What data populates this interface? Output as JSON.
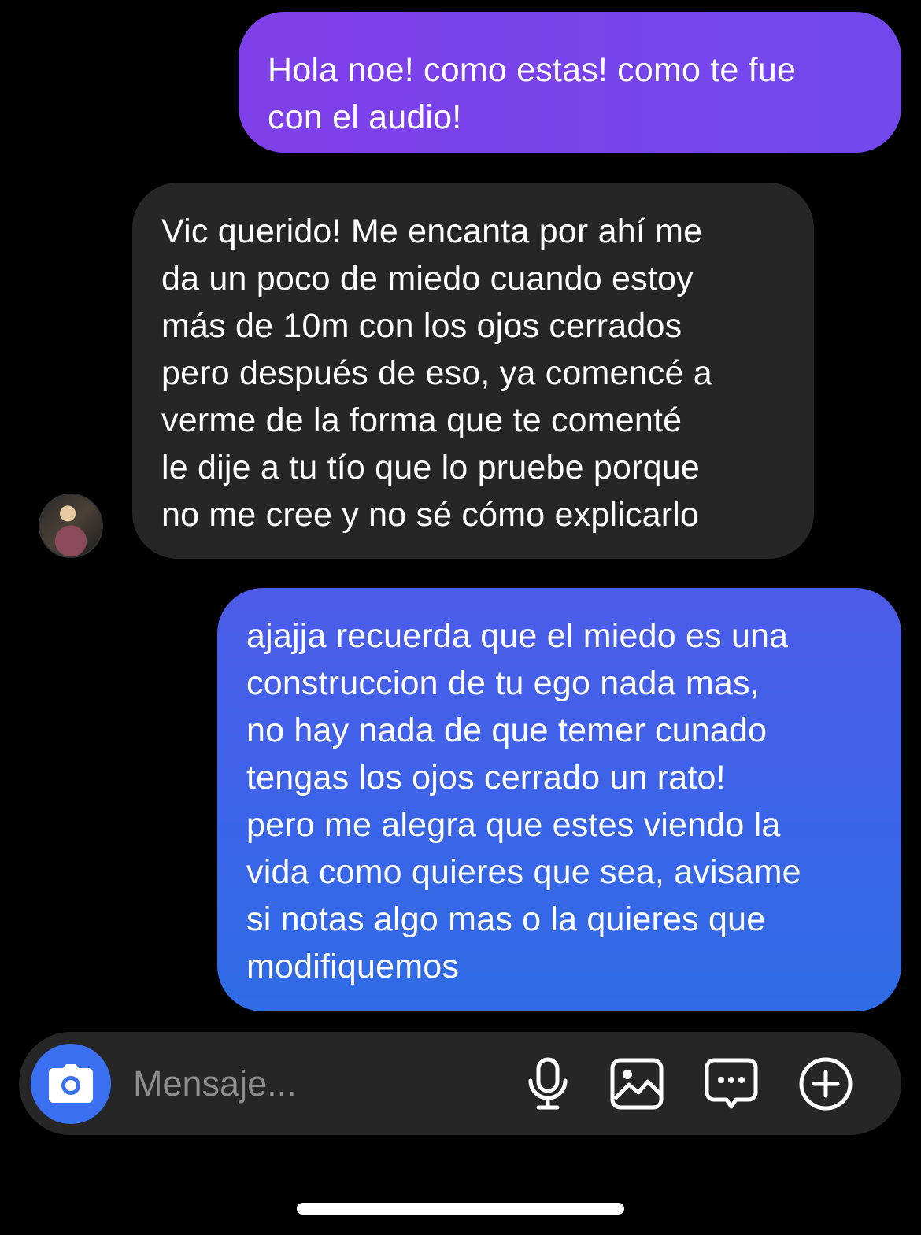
{
  "messages": [
    {
      "sender": "me",
      "text": "Hola noe! como estas! como te fue\ncon el audio!"
    },
    {
      "sender": "contact",
      "text": "Vic querido! Me encanta por ahí me\nda un poco de miedo cuando estoy\nmás de 10m con los ojos cerrados\npero después de eso, ya comencé a\nverme de la forma que te comenté\nle dije a tu tío que lo pruebe porque\nno me cree y no sé cómo explicarlo"
    },
    {
      "sender": "me",
      "text": "ajajja recuerda que el miedo es una\nconstruccion de tu ego nada mas,\nno hay nada de que temer cunado\ntengas los ojos cerrado un rato!\npero me alegra que estes viendo la\nvida como quieres que sea, avisame\nsi notas algo mas o la quieres que\nmodifiquemos"
    }
  ],
  "composer": {
    "placeholder": "Mensaje...",
    "icons": [
      "camera-icon",
      "microphone-icon",
      "gallery-icon",
      "sticker-icon",
      "plus-icon"
    ]
  },
  "colors": {
    "background": "#000000",
    "incoming_bubble": "#262626",
    "outgoing_purple": "#7f3fe9",
    "outgoing_blue": "#2f6ce6",
    "camera_button": "#3a6ff0"
  }
}
